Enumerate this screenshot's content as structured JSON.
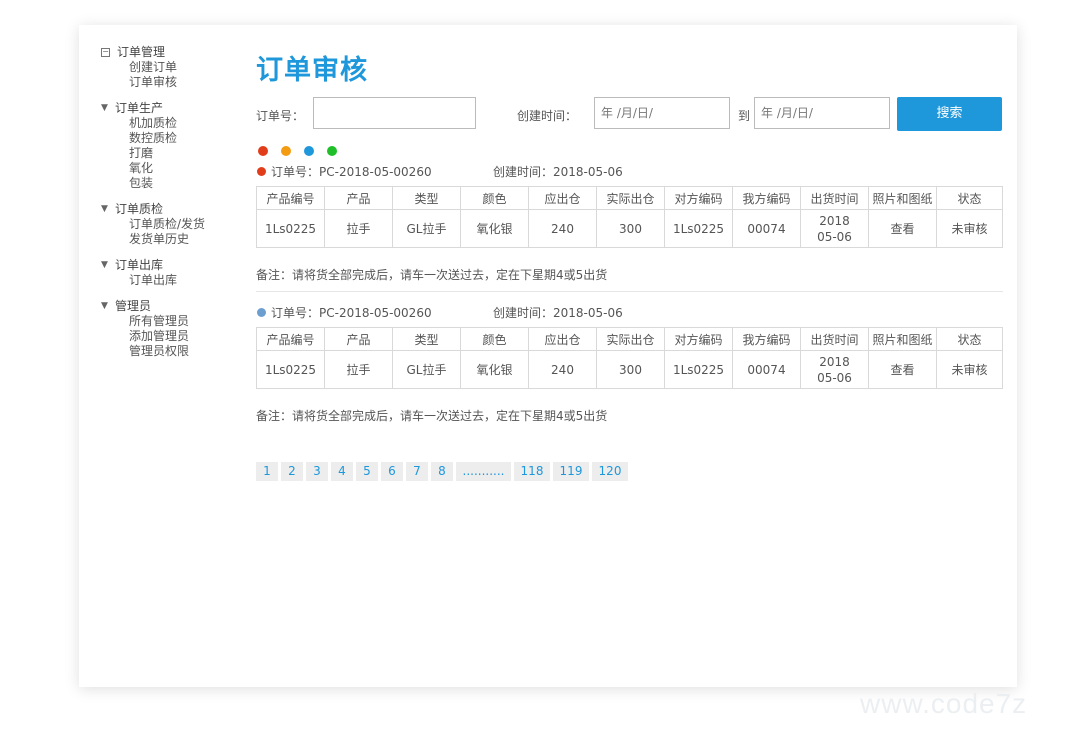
{
  "sidebar": {
    "groups": [
      {
        "title": "订单管理",
        "items": [
          "创建订单",
          "订单审核"
        ]
      },
      {
        "title": "订单生产",
        "items": [
          "机加质检",
          "数控质检",
          "打磨",
          "氧化",
          "包装"
        ]
      },
      {
        "title": "订单质检",
        "items": [
          "订单质检/发货",
          "发货单历史"
        ]
      },
      {
        "title": "订单出库",
        "items": [
          "订单出库"
        ]
      },
      {
        "title": "管理员",
        "items": [
          "所有管理员",
          "添加管理员",
          "管理员权限"
        ]
      }
    ],
    "icons": {
      "expanded": "minus-box-icon",
      "collapsed": "triangle-down-icon"
    }
  },
  "page_title": "订单审核",
  "search": {
    "order_no_label": "订单号：",
    "order_no_value": "",
    "created_time_label": "创建时间：",
    "date_from_placeholder": "年 /月/日/",
    "to_label": "到",
    "date_to_placeholder": "年 /月/日/",
    "button_label": "搜索"
  },
  "status_dots": [
    "#e23d1a",
    "#f39c12",
    "#1e97db",
    "#1fbf2a"
  ],
  "table_headers": [
    "产品编号",
    "产品",
    "类型",
    "颜色",
    "应出仓",
    "实际出仓",
    "对方编码",
    "我方编码",
    "出货时间",
    "照片和图纸",
    "状态"
  ],
  "orders": [
    {
      "dot_color": "#e23d1a",
      "order_no": "订单号：PC-2018-05-00260",
      "created": "创建时间：2018-05-06",
      "row": [
        "1Ls0225",
        "拉手",
        "GL拉手",
        "氧化银",
        "240",
        "300",
        "1Ls0225",
        "00074",
        "2018\n05-06",
        "查看",
        "未审核"
      ],
      "remark": "备注：请将货全部完成后，请车一次送过去，定在下星期4或5出货"
    },
    {
      "dot_color": "#6c9fd0",
      "order_no": "订单号：PC-2018-05-00260",
      "created": "创建时间：2018-05-06",
      "row": [
        "1Ls0225",
        "拉手",
        "GL拉手",
        "氧化银",
        "240",
        "300",
        "1Ls0225",
        "00074",
        "2018\n05-06",
        "查看",
        "未审核"
      ],
      "remark": "备注：请将货全部完成后，请车一次送过去，定在下星期4或5出货"
    }
  ],
  "pagination": [
    "1",
    "2",
    "3",
    "4",
    "5",
    "6",
    "7",
    "8",
    "...........",
    "118",
    "119",
    "120"
  ],
  "watermark": "www.code7z"
}
